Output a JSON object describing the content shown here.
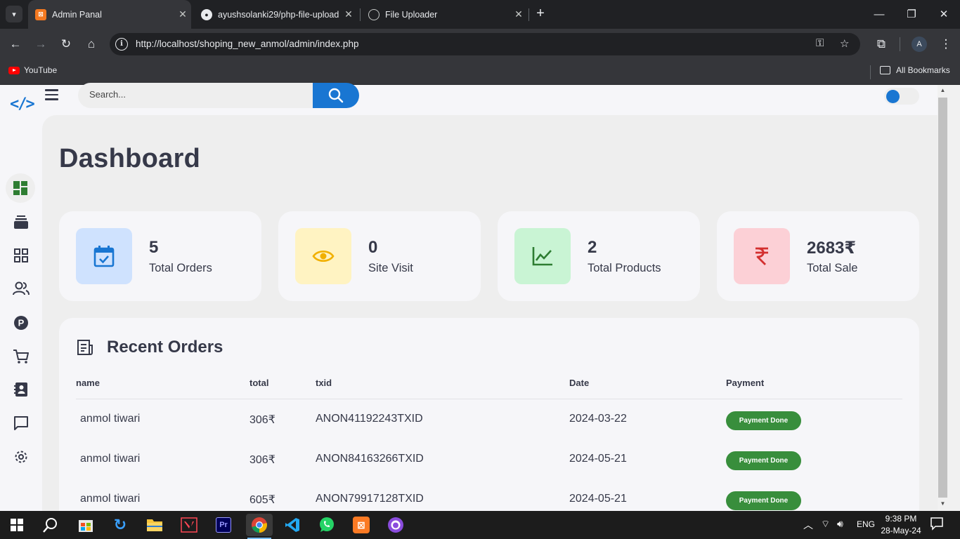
{
  "browser": {
    "tabs": [
      {
        "title": "Admin Panal"
      },
      {
        "title": "ayushsolanki29/php-file-upload"
      },
      {
        "title": "File Uploader"
      }
    ],
    "url": "http://localhost/shoping_new_anmol/admin/index.php",
    "bookmarks": {
      "youtube": "YouTube",
      "all": "All Bookmarks"
    },
    "profile_initial": "A"
  },
  "header": {
    "logo": "</>",
    "search_placeholder": "Search..."
  },
  "page_title": "Dashboard",
  "cards": [
    {
      "value": "5",
      "label": "Total Orders",
      "icon": "calendar-check-icon",
      "bg": "#cfe2fe",
      "color": "#1976d2"
    },
    {
      "value": "0",
      "label": "Site Visit",
      "icon": "eye-icon",
      "bg": "#fff3c2",
      "color": "#f1b000"
    },
    {
      "value": "2",
      "label": "Total Products",
      "icon": "chart-line-icon",
      "bg": "#c9f4d4",
      "color": "#2e7d32"
    },
    {
      "value": "2683₹",
      "label": "Total Sale",
      "icon": "rupee-icon",
      "bg": "#fcd0d6",
      "color": "#d32f2f"
    }
  ],
  "recent_orders": {
    "title": "Recent Orders",
    "columns": [
      "name",
      "total",
      "txid",
      "Date",
      "Payment"
    ],
    "rows": [
      {
        "name": "anmol tiwari",
        "total": "306₹",
        "txid": "ANON41192243TXID",
        "date": "2024-03-22",
        "payment": "Payment Done"
      },
      {
        "name": "anmol tiwari",
        "total": "306₹",
        "txid": "ANON84163266TXID",
        "date": "2024-05-21",
        "payment": "Payment Done"
      },
      {
        "name": "anmol tiwari",
        "total": "605₹",
        "txid": "ANON79917128TXID",
        "date": "2024-05-21",
        "payment": "Payment Done"
      }
    ]
  },
  "taskbar": {
    "lang": "ENG",
    "time": "9:38 PM",
    "date": "28-May-24"
  },
  "colors": {
    "accent": "#1976d2",
    "success": "#388e3c",
    "text": "#363949"
  }
}
